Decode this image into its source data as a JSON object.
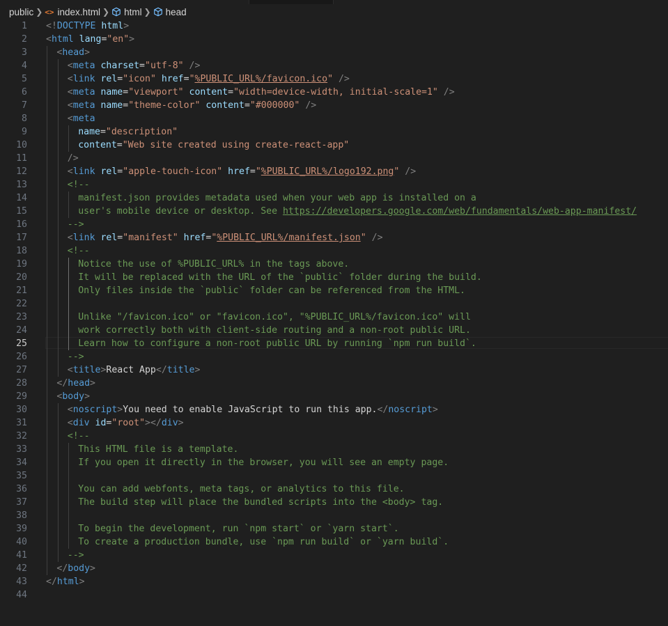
{
  "breadcrumb": {
    "folder": "public",
    "file": "index.html",
    "node1": "html",
    "node2": "head",
    "file_icon": "html-file-icon",
    "node_icon": "symbol-cube-icon"
  },
  "editor": {
    "active_line": 25,
    "lines": [
      {
        "n": "1",
        "indent": 0,
        "guides": [],
        "tokens": [
          [
            "punc",
            "<!"
          ],
          [
            "tag",
            "DOCTYPE"
          ],
          [
            "text",
            " "
          ],
          [
            "attr",
            "html"
          ],
          [
            "punc",
            ">"
          ]
        ]
      },
      {
        "n": "2",
        "indent": 0,
        "guides": [],
        "tokens": [
          [
            "punc",
            "<"
          ],
          [
            "tag",
            "html"
          ],
          [
            "text",
            " "
          ],
          [
            "attr",
            "lang"
          ],
          [
            "eq",
            "="
          ],
          [
            "str",
            "\"en\""
          ],
          [
            "punc",
            ">"
          ]
        ]
      },
      {
        "n": "3",
        "indent": 1,
        "guides": [
          0
        ],
        "tokens": [
          [
            "punc",
            "<"
          ],
          [
            "tag",
            "head"
          ],
          [
            "punc",
            ">"
          ]
        ]
      },
      {
        "n": "4",
        "indent": 2,
        "guides": [
          0,
          1
        ],
        "tokens": [
          [
            "punc",
            "<"
          ],
          [
            "tag",
            "meta"
          ],
          [
            "text",
            " "
          ],
          [
            "attr",
            "charset"
          ],
          [
            "eq",
            "="
          ],
          [
            "str",
            "\"utf-8\""
          ],
          [
            "text",
            " "
          ],
          [
            "punc",
            "/>"
          ]
        ]
      },
      {
        "n": "5",
        "indent": 2,
        "guides": [
          0,
          1
        ],
        "tokens": [
          [
            "punc",
            "<"
          ],
          [
            "tag",
            "link"
          ],
          [
            "text",
            " "
          ],
          [
            "attr",
            "rel"
          ],
          [
            "eq",
            "="
          ],
          [
            "str",
            "\"icon\""
          ],
          [
            "text",
            " "
          ],
          [
            "attr",
            "href"
          ],
          [
            "eq",
            "="
          ],
          [
            "str",
            "\""
          ],
          [
            "strlink",
            "%PUBLIC_URL%/favicon.ico"
          ],
          [
            "str",
            "\""
          ],
          [
            "text",
            " "
          ],
          [
            "punc",
            "/>"
          ]
        ]
      },
      {
        "n": "6",
        "indent": 2,
        "guides": [
          0,
          1
        ],
        "tokens": [
          [
            "punc",
            "<"
          ],
          [
            "tag",
            "meta"
          ],
          [
            "text",
            " "
          ],
          [
            "attr",
            "name"
          ],
          [
            "eq",
            "="
          ],
          [
            "str",
            "\"viewport\""
          ],
          [
            "text",
            " "
          ],
          [
            "attr",
            "content"
          ],
          [
            "eq",
            "="
          ],
          [
            "str",
            "\"width=device-width, initial-scale=1\""
          ],
          [
            "text",
            " "
          ],
          [
            "punc",
            "/>"
          ]
        ]
      },
      {
        "n": "7",
        "indent": 2,
        "guides": [
          0,
          1
        ],
        "tokens": [
          [
            "punc",
            "<"
          ],
          [
            "tag",
            "meta"
          ],
          [
            "text",
            " "
          ],
          [
            "attr",
            "name"
          ],
          [
            "eq",
            "="
          ],
          [
            "str",
            "\"theme-color\""
          ],
          [
            "text",
            " "
          ],
          [
            "attr",
            "content"
          ],
          [
            "eq",
            "="
          ],
          [
            "str",
            "\"#000000\""
          ],
          [
            "text",
            " "
          ],
          [
            "punc",
            "/>"
          ]
        ]
      },
      {
        "n": "8",
        "indent": 2,
        "guides": [
          0,
          1
        ],
        "tokens": [
          [
            "punc",
            "<"
          ],
          [
            "tag",
            "meta"
          ]
        ]
      },
      {
        "n": "9",
        "indent": 3,
        "guides": [
          0,
          1,
          2
        ],
        "tokens": [
          [
            "attr",
            "name"
          ],
          [
            "eq",
            "="
          ],
          [
            "str",
            "\"description\""
          ]
        ]
      },
      {
        "n": "10",
        "indent": 3,
        "guides": [
          0,
          1,
          2
        ],
        "tokens": [
          [
            "attr",
            "content"
          ],
          [
            "eq",
            "="
          ],
          [
            "str",
            "\"Web site created using create-react-app\""
          ]
        ]
      },
      {
        "n": "11",
        "indent": 2,
        "guides": [
          0,
          1
        ],
        "tokens": [
          [
            "punc",
            "/>"
          ]
        ]
      },
      {
        "n": "12",
        "indent": 2,
        "guides": [
          0,
          1
        ],
        "tokens": [
          [
            "punc",
            "<"
          ],
          [
            "tag",
            "link"
          ],
          [
            "text",
            " "
          ],
          [
            "attr",
            "rel"
          ],
          [
            "eq",
            "="
          ],
          [
            "str",
            "\"apple-touch-icon\""
          ],
          [
            "text",
            " "
          ],
          [
            "attr",
            "href"
          ],
          [
            "eq",
            "="
          ],
          [
            "str",
            "\""
          ],
          [
            "strlink",
            "%PUBLIC_URL%/logo192.png"
          ],
          [
            "str",
            "\""
          ],
          [
            "text",
            " "
          ],
          [
            "punc",
            "/>"
          ]
        ]
      },
      {
        "n": "13",
        "indent": 2,
        "guides": [
          0,
          1
        ],
        "tokens": [
          [
            "com",
            "<!--"
          ]
        ]
      },
      {
        "n": "14",
        "indent": 3,
        "guides": [
          0,
          1,
          2
        ],
        "tokens": [
          [
            "com",
            "manifest.json provides metadata used when your web app is installed on a"
          ]
        ]
      },
      {
        "n": "15",
        "indent": 3,
        "guides": [
          0,
          1,
          2
        ],
        "tokens": [
          [
            "com",
            "user's mobile device or desktop. See "
          ],
          [
            "comlink",
            "https://developers.google.com/web/fundamentals/web-app-manifest/"
          ]
        ]
      },
      {
        "n": "16",
        "indent": 2,
        "guides": [
          0,
          1
        ],
        "tokens": [
          [
            "com",
            "-->"
          ]
        ]
      },
      {
        "n": "17",
        "indent": 2,
        "guides": [
          0,
          1
        ],
        "tokens": [
          [
            "punc",
            "<"
          ],
          [
            "tag",
            "link"
          ],
          [
            "text",
            " "
          ],
          [
            "attr",
            "rel"
          ],
          [
            "eq",
            "="
          ],
          [
            "str",
            "\"manifest\""
          ],
          [
            "text",
            " "
          ],
          [
            "attr",
            "href"
          ],
          [
            "eq",
            "="
          ],
          [
            "str",
            "\""
          ],
          [
            "strlink",
            "%PUBLIC_URL%/manifest.json"
          ],
          [
            "str",
            "\""
          ],
          [
            "text",
            " "
          ],
          [
            "punc",
            "/>"
          ]
        ]
      },
      {
        "n": "18",
        "indent": 2,
        "guides": [
          0,
          1
        ],
        "tokens": [
          [
            "com",
            "<!--"
          ]
        ]
      },
      {
        "n": "19",
        "indent": 3,
        "guides": [
          0,
          1,
          2
        ],
        "tokens": [
          [
            "com",
            "Notice the use of %PUBLIC_URL% in the tags above."
          ]
        ]
      },
      {
        "n": "20",
        "indent": 3,
        "guides": [
          0,
          1,
          2
        ],
        "tokens": [
          [
            "com",
            "It will be replaced with the URL of the `public` folder during the build."
          ]
        ]
      },
      {
        "n": "21",
        "indent": 3,
        "guides": [
          0,
          1,
          2
        ],
        "tokens": [
          [
            "com",
            "Only files inside the `public` folder can be referenced from the HTML."
          ]
        ]
      },
      {
        "n": "22",
        "indent": 3,
        "guides": [
          0,
          1,
          2
        ],
        "tokens": []
      },
      {
        "n": "23",
        "indent": 3,
        "guides": [
          0,
          1,
          2
        ],
        "tokens": [
          [
            "com",
            "Unlike \"/favicon.ico\" or \"favicon.ico\", \"%PUBLIC_URL%/favicon.ico\" will"
          ]
        ]
      },
      {
        "n": "24",
        "indent": 3,
        "guides": [
          0,
          1,
          2
        ],
        "tokens": [
          [
            "com",
            "work correctly both with client-side routing and a non-root public URL."
          ]
        ]
      },
      {
        "n": "25",
        "indent": 3,
        "guides": [
          0,
          1,
          2
        ],
        "tokens": [
          [
            "com",
            "Learn how to configure a non-root public URL by running `npm run build`."
          ]
        ]
      },
      {
        "n": "26",
        "indent": 2,
        "guides": [
          0,
          1
        ],
        "tokens": [
          [
            "com",
            "-->"
          ]
        ]
      },
      {
        "n": "27",
        "indent": 2,
        "guides": [
          0,
          1
        ],
        "tokens": [
          [
            "punc",
            "<"
          ],
          [
            "tag",
            "title"
          ],
          [
            "punc",
            ">"
          ],
          [
            "text",
            "React App"
          ],
          [
            "punc",
            "</"
          ],
          [
            "tag",
            "title"
          ],
          [
            "punc",
            ">"
          ]
        ]
      },
      {
        "n": "28",
        "indent": 1,
        "guides": [
          0
        ],
        "tokens": [
          [
            "punc",
            "</"
          ],
          [
            "tag",
            "head"
          ],
          [
            "punc",
            ">"
          ]
        ]
      },
      {
        "n": "29",
        "indent": 1,
        "guides": [
          0
        ],
        "tokens": [
          [
            "punc",
            "<"
          ],
          [
            "tag",
            "body"
          ],
          [
            "punc",
            ">"
          ]
        ]
      },
      {
        "n": "30",
        "indent": 2,
        "guides": [
          0,
          1
        ],
        "tokens": [
          [
            "punc",
            "<"
          ],
          [
            "tag",
            "noscript"
          ],
          [
            "punc",
            ">"
          ],
          [
            "text",
            "You need to enable JavaScript to run this app."
          ],
          [
            "punc",
            "</"
          ],
          [
            "tag",
            "noscript"
          ],
          [
            "punc",
            ">"
          ]
        ]
      },
      {
        "n": "31",
        "indent": 2,
        "guides": [
          0,
          1
        ],
        "tokens": [
          [
            "punc",
            "<"
          ],
          [
            "tag",
            "div"
          ],
          [
            "text",
            " "
          ],
          [
            "attr",
            "id"
          ],
          [
            "eq",
            "="
          ],
          [
            "str",
            "\"root\""
          ],
          [
            "punc",
            "></"
          ],
          [
            "tag",
            "div"
          ],
          [
            "punc",
            ">"
          ]
        ]
      },
      {
        "n": "32",
        "indent": 2,
        "guides": [
          0,
          1
        ],
        "tokens": [
          [
            "com",
            "<!--"
          ]
        ]
      },
      {
        "n": "33",
        "indent": 3,
        "guides": [
          0,
          1,
          2
        ],
        "tokens": [
          [
            "com",
            "This HTML file is a template."
          ]
        ]
      },
      {
        "n": "34",
        "indent": 3,
        "guides": [
          0,
          1,
          2
        ],
        "tokens": [
          [
            "com",
            "If you open it directly in the browser, you will see an empty page."
          ]
        ]
      },
      {
        "n": "35",
        "indent": 3,
        "guides": [
          0,
          1,
          2
        ],
        "tokens": []
      },
      {
        "n": "36",
        "indent": 3,
        "guides": [
          0,
          1,
          2
        ],
        "tokens": [
          [
            "com",
            "You can add webfonts, meta tags, or analytics to this file."
          ]
        ]
      },
      {
        "n": "37",
        "indent": 3,
        "guides": [
          0,
          1,
          2
        ],
        "tokens": [
          [
            "com",
            "The build step will place the bundled scripts into the <body> tag."
          ]
        ]
      },
      {
        "n": "38",
        "indent": 3,
        "guides": [
          0,
          1,
          2
        ],
        "tokens": []
      },
      {
        "n": "39",
        "indent": 3,
        "guides": [
          0,
          1,
          2
        ],
        "tokens": [
          [
            "com",
            "To begin the development, run `npm start` or `yarn start`."
          ]
        ]
      },
      {
        "n": "40",
        "indent": 3,
        "guides": [
          0,
          1,
          2
        ],
        "tokens": [
          [
            "com",
            "To create a production bundle, use `npm run build` or `yarn build`."
          ]
        ]
      },
      {
        "n": "41",
        "indent": 2,
        "guides": [
          0,
          1
        ],
        "tokens": [
          [
            "com",
            "-->"
          ]
        ]
      },
      {
        "n": "42",
        "indent": 1,
        "guides": [
          0
        ],
        "tokens": [
          [
            "punc",
            "</"
          ],
          [
            "tag",
            "body"
          ],
          [
            "punc",
            ">"
          ]
        ]
      },
      {
        "n": "43",
        "indent": 0,
        "guides": [],
        "tokens": [
          [
            "punc",
            "</"
          ],
          [
            "tag",
            "html"
          ],
          [
            "punc",
            ">"
          ]
        ]
      },
      {
        "n": "44",
        "indent": 0,
        "guides": [],
        "tokens": []
      }
    ]
  }
}
